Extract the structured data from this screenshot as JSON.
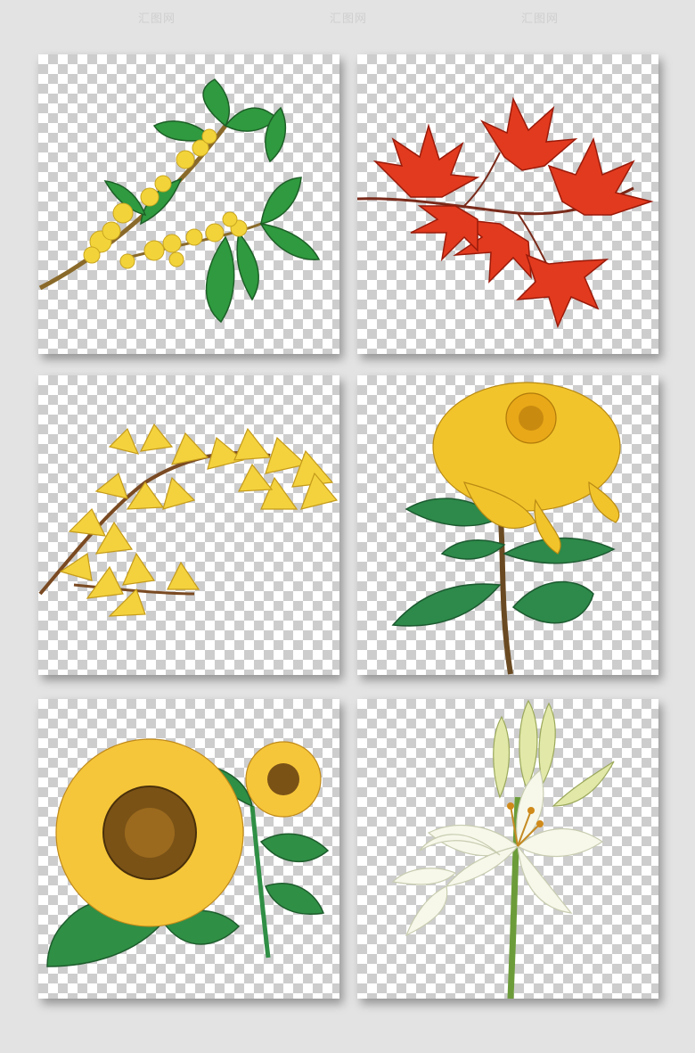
{
  "watermarks": [
    "汇图网",
    "汇图网",
    "汇图网"
  ],
  "tiles": [
    {
      "subject": "osmanthus-branch",
      "colors": {
        "leaf": "#2f9a3f",
        "flower": "#f2d43a",
        "stem": "#8a6a2a"
      }
    },
    {
      "subject": "red-maple-branch",
      "colors": {
        "leaf": "#e23a1e",
        "stem": "#7a2a1a"
      }
    },
    {
      "subject": "ginkgo-branch",
      "colors": {
        "leaf": "#f3d23e",
        "stem": "#7a4a22"
      }
    },
    {
      "subject": "yellow-chrysanthemum",
      "colors": {
        "petal": "#f2c42c",
        "leaf": "#2d8a4a",
        "stem": "#6a4a22"
      }
    },
    {
      "subject": "sunflowers",
      "colors": {
        "petal": "#f6c63a",
        "center": "#7a5216",
        "leaf": "#2f8f45"
      }
    },
    {
      "subject": "white-lily",
      "colors": {
        "petal": "#f7f8ea",
        "bud": "#e2e8a8",
        "stem": "#6c9c3a"
      }
    }
  ]
}
